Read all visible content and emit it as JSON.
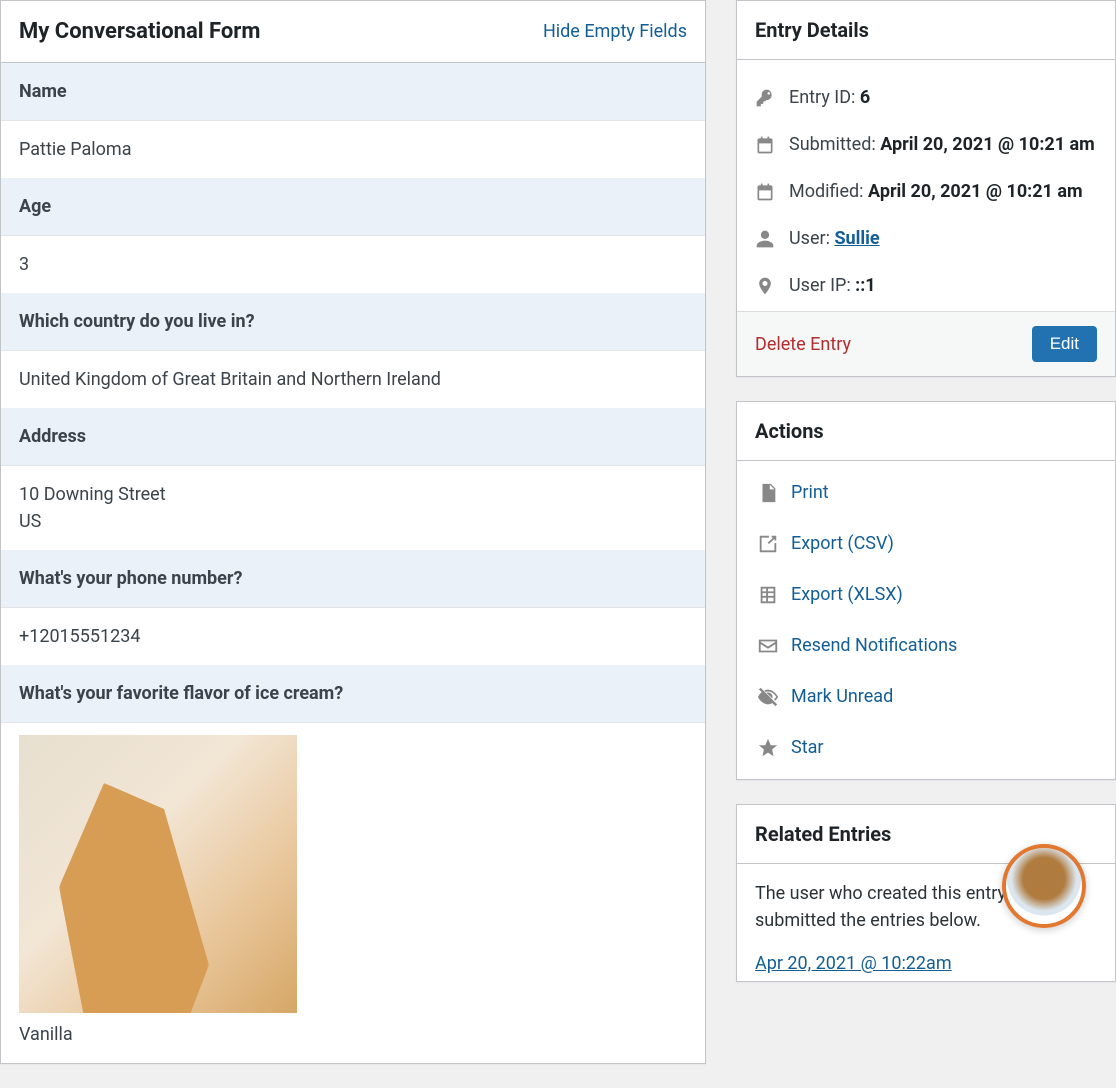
{
  "form": {
    "title": "My Conversational Form",
    "hide_empty_label": "Hide Empty Fields",
    "fields": [
      {
        "label": "Name",
        "value": "Pattie Paloma"
      },
      {
        "label": "Age",
        "value": "3"
      },
      {
        "label": "Which country do you live in?",
        "value": "United Kingdom of Great Britain and Northern Ireland"
      },
      {
        "label": "Address",
        "value": "10 Downing Street\nUS"
      },
      {
        "label": "What's your phone number?",
        "value": "+12015551234"
      },
      {
        "label": "What's your favorite flavor of ice cream?",
        "value": "Vanilla",
        "has_image": true
      }
    ]
  },
  "entry_details": {
    "title": "Entry Details",
    "id_label": "Entry ID: ",
    "id_value": "6",
    "submitted_label": "Submitted: ",
    "submitted_value": "April 20, 2021 @ 10:21 am",
    "modified_label": "Modified: ",
    "modified_value": "April 20, 2021 @ 10:21 am",
    "user_label": "User: ",
    "user_value": "Sullie",
    "ip_label": "User IP: ",
    "ip_value": "::1",
    "delete_label": "Delete Entry",
    "edit_label": "Edit"
  },
  "actions": {
    "title": "Actions",
    "items": [
      {
        "icon": "file",
        "label": "Print"
      },
      {
        "icon": "export",
        "label": "Export (CSV)"
      },
      {
        "icon": "spreadsheet",
        "label": "Export (XLSX)"
      },
      {
        "icon": "mail",
        "label": "Resend Notifications"
      },
      {
        "icon": "eyeoff",
        "label": "Mark Unread"
      },
      {
        "icon": "star",
        "label": "Star"
      }
    ]
  },
  "related": {
    "title": "Related Entries",
    "text": "The user who created this entry also submitted the entries below.",
    "link": "Apr 20, 2021 @ 10:22am"
  }
}
